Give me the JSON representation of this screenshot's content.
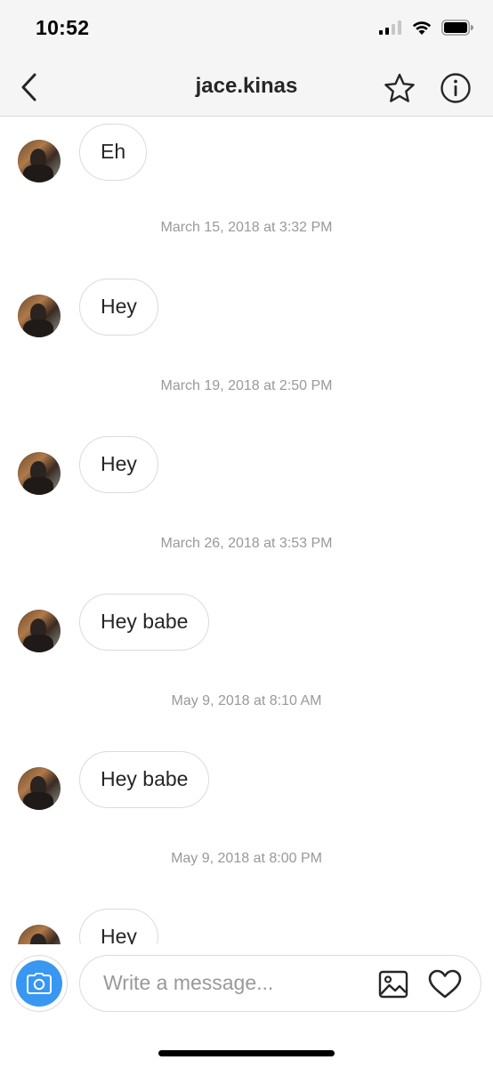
{
  "status_bar": {
    "time": "10:52"
  },
  "header": {
    "title": "jace.kinas",
    "back_icon": "chevron-left-icon",
    "star_icon": "star-icon",
    "info_icon": "info-icon"
  },
  "messages": [
    {
      "text": "Eh"
    },
    {
      "timestamp": "March 15, 2018 at 3:32 PM"
    },
    {
      "text": "Hey"
    },
    {
      "timestamp": "March 19, 2018 at 2:50 PM"
    },
    {
      "text": "Hey"
    },
    {
      "timestamp": "March 26, 2018 at 3:53 PM"
    },
    {
      "text": "Hey babe"
    },
    {
      "timestamp": "May 9, 2018 at 8:10 AM"
    },
    {
      "text": "Hey babe"
    },
    {
      "timestamp": "May 9, 2018 at 8:00 PM"
    },
    {
      "text": "Hey"
    }
  ],
  "composer": {
    "placeholder": "Write a message...",
    "camera_icon": "camera-icon",
    "gallery_icon": "image-icon",
    "heart_icon": "heart-icon"
  },
  "colors": {
    "accent": "#3897f0",
    "border": "#dbdbdb",
    "timestamp_text": "#999999",
    "bar_background": "#f5f5f5"
  }
}
